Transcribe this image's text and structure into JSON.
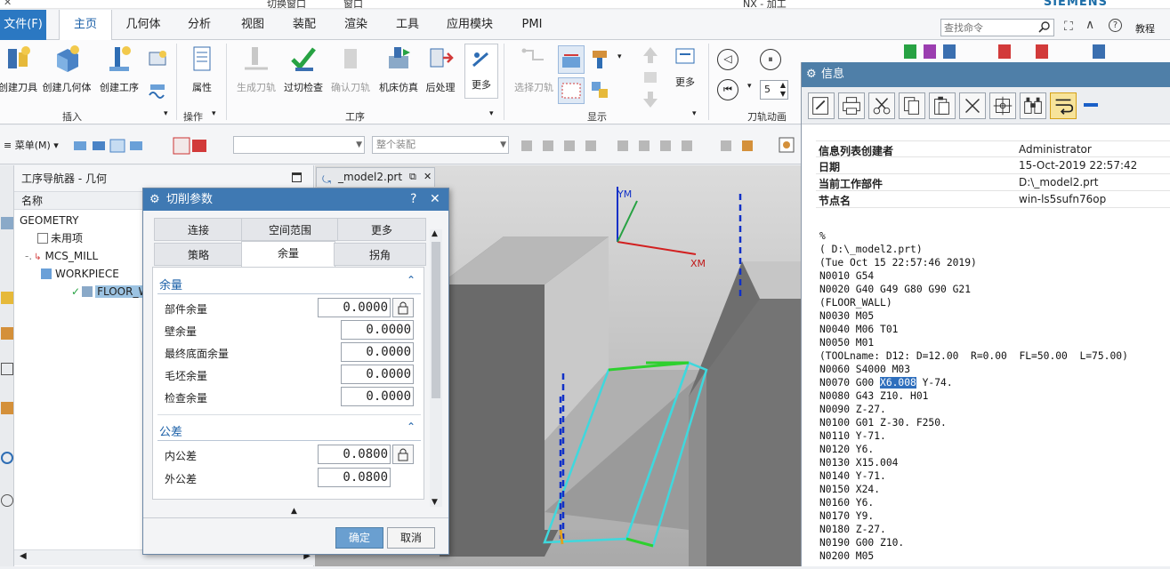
{
  "window": {
    "title": "NX - 加工",
    "brand": "SIEMENS",
    "quick_window_switch": "切换窗口",
    "window_menu": "窗口"
  },
  "menu_tabs": {
    "file": "文件(F)",
    "items": [
      "主页",
      "几何体",
      "分析",
      "视图",
      "装配",
      "渲染",
      "工具",
      "应用模块",
      "PMI"
    ],
    "active": "主页"
  },
  "command_search": {
    "placeholder": "查找命令"
  },
  "help_label": "教程",
  "ribbon": {
    "insert_buttons": [
      "创建刀具",
      "创建几何体",
      "创建工序"
    ],
    "insert_group": "插入",
    "attribute_button": "属性",
    "operation_group": "操作",
    "operation_buttons": [
      "生成刀轨",
      "过切检查",
      "确认刀轨",
      "机床仿真",
      "后处理",
      "更多"
    ],
    "operation_buttons_disabled": [
      true,
      false,
      true,
      false,
      false,
      false
    ],
    "procedure_group": "工序",
    "display_buttons": [
      "选择刀轨",
      "更多"
    ],
    "display_group": "显示",
    "animation_group": "刀轨动画",
    "speed_value": "5"
  },
  "toolbar2": {
    "menu_label": "菜单(M)",
    "filter_combo": "",
    "assembly_combo": "整个装配"
  },
  "navigator": {
    "title": "工序导航器 - 几何",
    "column_name": "名称",
    "items": [
      {
        "label": "GEOMETRY",
        "icon": "folder-icon"
      },
      {
        "label": "未用项",
        "icon": "unused-icon"
      },
      {
        "label": "MCS_MILL",
        "icon": "mcs-icon"
      },
      {
        "label": "WORKPIECE",
        "icon": "workpiece-icon"
      },
      {
        "label": "FLOOR_WALL",
        "icon": "operation-icon"
      }
    ]
  },
  "viewport": {
    "tab_label": "_model2.prt",
    "axis_y": "YM",
    "axis_x": "XM"
  },
  "dialog": {
    "title": "切削参数",
    "tabs_row1": [
      "连接",
      "空间范围",
      "更多"
    ],
    "tabs_row2": [
      "策略",
      "余量",
      "拐角"
    ],
    "active_tab": "余量",
    "allowance_section": "余量",
    "allowance_fields": [
      {
        "label": "部件余量",
        "value": "0.0000"
      },
      {
        "label": "壁余量",
        "value": "0.0000"
      },
      {
        "label": "最终底面余量",
        "value": "0.0000"
      },
      {
        "label": "毛坯余量",
        "value": "0.0000"
      },
      {
        "label": "检查余量",
        "value": "0.0000"
      }
    ],
    "tolerance_section": "公差",
    "tolerance_fields": [
      {
        "label": "内公差",
        "value": "0.0800"
      },
      {
        "label": "外公差",
        "value": "0.0800"
      }
    ],
    "ok": "确定",
    "cancel": "取消"
  },
  "info": {
    "title": "信息",
    "rows": [
      {
        "key": "信息列表创建者",
        "value": "Administrator"
      },
      {
        "key": "日期",
        "value": "15-Oct-2019 22:57:42"
      },
      {
        "key": "当前工作部件",
        "value": "D:\\_model2.prt"
      },
      {
        "key": "节点名",
        "value": "win-ls5sufn76op"
      }
    ],
    "nc_lines": [
      "%",
      "( D:\\_model2.prt)",
      "(Tue Oct 15 22:57:46 2019)",
      "N0010 G54",
      "N0020 G40 G49 G80 G90 G21",
      "(FLOOR_WALL)",
      "N0030 M05",
      "N0040 M06 T01",
      "N0050 M01",
      "(TOOLname: D12: D=12.00  R=0.00  FL=50.00  L=75.00)",
      "N0060 S4000 M03",
      "N0070 G00 ",
      "N0080 G43 Z10. H01",
      "N0090 Z-27.",
      "N0100 G01 Z-30. F250.",
      "N0110 Y-71.",
      "N0120 Y6.",
      "N0130 X15.004",
      "N0140 Y-71.",
      "N0150 X24.",
      "N0160 Y6.",
      "N0170 Y9.",
      "N0180 Z-27.",
      "N0190 G00 Z10.",
      "N0200 M05"
    ],
    "highlight_word": "X6.008",
    "after_highlight": " Y-74."
  }
}
